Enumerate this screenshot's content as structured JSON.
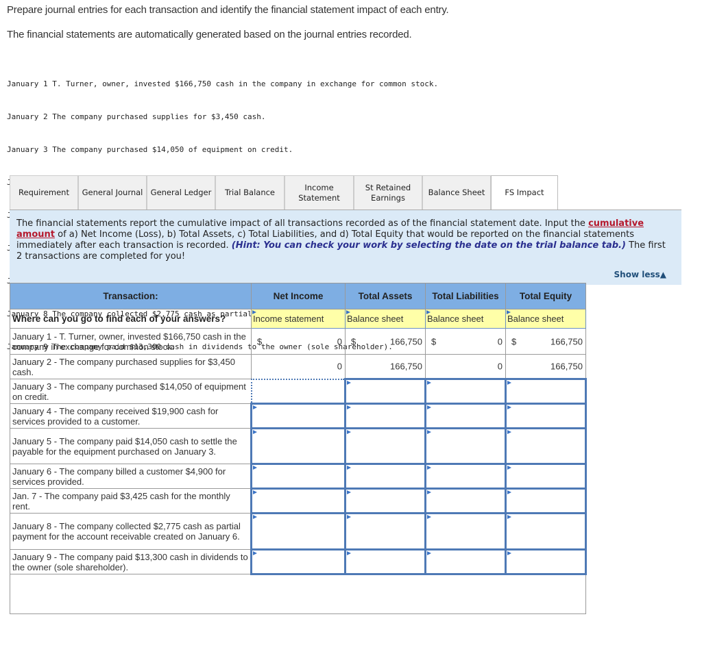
{
  "intro": {
    "line1": "Prepare journal entries for each transaction and identify the financial statement impact of each entry.",
    "line2": "The financial statements are automatically generated based on the journal entries recorded."
  },
  "transactions_list": [
    {
      "date": "January 1",
      "text": "T. Turner, owner, invested $166,750 cash in the company in exchange for common stock."
    },
    {
      "date": "January 2",
      "text": "The company purchased supplies for $3,450 cash."
    },
    {
      "date": "January 3",
      "text": "The company purchased $14,050 of equipment on credit."
    },
    {
      "date": "January 4",
      "text": "The company received $19,900 cash for services provided to a customer."
    },
    {
      "date": "January 5",
      "text": "The company paid $14,050 cash to settle the payable for the equipment purchased on January 3."
    },
    {
      "date": "January 6",
      "text": "The company billed a customer $4,900 for services provided."
    },
    {
      "date": "January 7",
      "text": "The company paid $3,425 cash for the monthly rent."
    },
    {
      "date": "January 8",
      "text": "The company collected $2,775 cash as partial payment for the account receivable created on January 6."
    },
    {
      "date": "January 9",
      "text": "The company paid $13,300 cash in dividends to the owner (sole shareholder)."
    }
  ],
  "tabs": [
    {
      "label": "Requirement",
      "active": false
    },
    {
      "label": "General Journal",
      "active": false
    },
    {
      "label": "General Ledger",
      "active": false
    },
    {
      "label": "Trial Balance",
      "active": false
    },
    {
      "label": "Income Statement",
      "active": false
    },
    {
      "label": "St Retained Earnings",
      "active": false
    },
    {
      "label": "Balance Sheet",
      "active": false
    },
    {
      "label": "FS Impact",
      "active": true
    }
  ],
  "instructions": {
    "part1": "The financial statements report the cumulative impact of all transactions recorded as of the financial statement date. Input the ",
    "emphasis": "cumulative amount",
    "part2": " of a) Net Income (Loss), b) Total Assets, c) Total Liabilities, and d) Total Equity that would be reported on the financial statements immediately after each transaction is recorded. ",
    "hint": "(Hint: You can check your work by selecting the date on the trial balance tab.)",
    "part3": " The first 2 transactions are completed for you!",
    "show_less": "Show less"
  },
  "table": {
    "headers": [
      "Transaction:",
      "Net Income",
      "Total Assets",
      "Total Liabilities",
      "Total Equity"
    ],
    "where_label": "Where can you go to find each of your answers?",
    "where_values": [
      "Income statement",
      "Balance sheet",
      "Balance sheet",
      "Balance sheet"
    ],
    "currency": "$",
    "rows": [
      {
        "desc": "January 1 - T. Turner, owner, invested $166,750 cash in the company in exchange for common stock.",
        "values": [
          "0",
          "166,750",
          "0",
          "166,750"
        ],
        "show_currency": true
      },
      {
        "desc": "January 2 - The company purchased supplies for $3,450 cash.",
        "values": [
          "0",
          "166,750",
          "0",
          "166,750"
        ],
        "show_currency": false
      },
      {
        "desc": "January 3 - The company purchased $14,050 of equipment on credit.",
        "values": [
          "",
          "",
          "",
          ""
        ]
      },
      {
        "desc": "January 4 - The company received $19,900 cash for services provided to a customer.",
        "values": [
          "",
          "",
          "",
          ""
        ]
      },
      {
        "desc": "January 5 - The company paid $14,050 cash to settle the payable for the equipment purchased on January 3.",
        "values": [
          "",
          "",
          "",
          ""
        ]
      },
      {
        "desc": "January 6 - The company billed a customer $4,900 for services provided.",
        "values": [
          "",
          "",
          "",
          ""
        ]
      },
      {
        "desc": "Jan. 7 - The company paid $3,425 cash for the monthly rent.",
        "values": [
          "",
          "",
          "",
          ""
        ]
      },
      {
        "desc": "January 8 - The company collected $2,775 cash as partial payment for the account receivable created on January 6.",
        "values": [
          "",
          "",
          "",
          ""
        ]
      },
      {
        "desc": "January 9 - The company paid $13,300 cash in dividends to the owner (sole shareholder).",
        "values": [
          "",
          "",
          "",
          ""
        ]
      }
    ]
  },
  "colors": {
    "header_blue": "#7eaee3",
    "panel_blue": "#dbeaf7",
    "select_yellow": "#ffffa8",
    "input_border": "#4e79b5",
    "emphasis_red": "#b5182c",
    "hint_navy": "#2a2f8f"
  }
}
